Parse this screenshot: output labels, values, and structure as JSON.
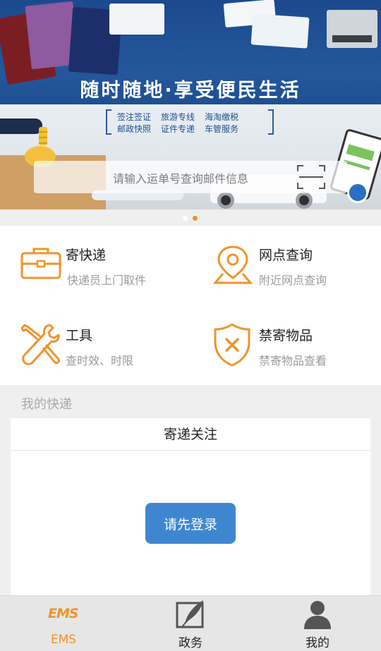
{
  "banner": {
    "headline": "随时随地·享受便民生活",
    "services_row1": [
      "签注签证",
      "旅游专线",
      "海淘缴税"
    ],
    "services_row2": [
      "邮政快照",
      "证件专递",
      "车管服务"
    ],
    "search_placeholder": "请输入运单号查询邮件信息",
    "carousel": {
      "count": 2,
      "active_index": 1,
      "accent": "#f0932b"
    }
  },
  "services": [
    {
      "title": "寄快递",
      "subtitle": "快递员上门取件",
      "icon": "briefcase-icon"
    },
    {
      "title": "网点查询",
      "subtitle": "附近网点查询",
      "icon": "location-pin-icon"
    },
    {
      "title": "工具",
      "subtitle": "查时效、时限",
      "icon": "wrench-icon"
    },
    {
      "title": "禁寄物品",
      "subtitle": "禁寄物品查看",
      "icon": "shield-x-icon"
    }
  ],
  "my_express": {
    "section_label": "我的快递",
    "panel_title": "寄递关注",
    "login_button": "请先登录"
  },
  "tabbar": {
    "items": [
      {
        "label": "EMS",
        "logo_text": "EMS",
        "icon": "ems-logo-icon",
        "active": true
      },
      {
        "label": "政务",
        "icon": "quill-icon",
        "active": false
      },
      {
        "label": "我的",
        "icon": "user-icon",
        "active": false
      }
    ]
  },
  "colors": {
    "accent": "#f0932b",
    "primary_button": "#3f86d1",
    "banner_blue": "#24579c"
  }
}
